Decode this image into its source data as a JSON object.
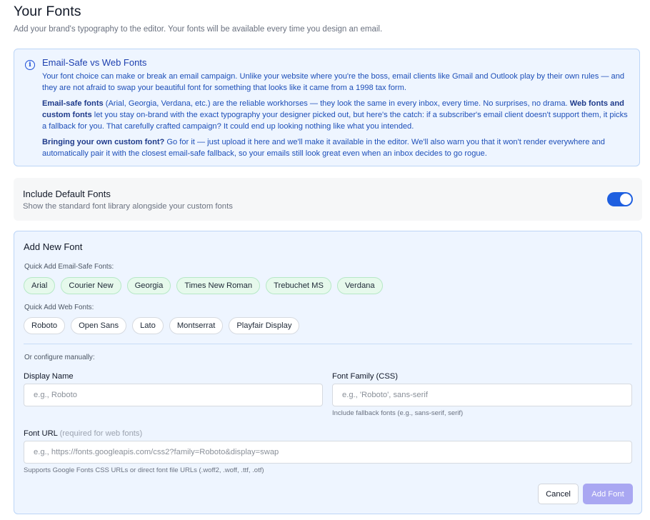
{
  "header": {
    "title": "Your Fonts",
    "subtitle": "Add your brand's typography to the editor. Your fonts will be available every time you design an email."
  },
  "info": {
    "icon": "info-icon",
    "title": "Email-Safe vs Web Fonts",
    "p1": "Your font choice can make or break an email campaign. Unlike your website where you're the boss, email clients like Gmail and Outlook play by their own rules — and they are not afraid to swap your beautiful font for something that looks like it came from a 1998 tax form.",
    "p2_bold1": "Email-safe fonts",
    "p2_text1": " (Arial, Georgia, Verdana, etc.) are the reliable workhorses — they look the same in every inbox, every time. No surprises, no drama. ",
    "p2_bold2": "Web fonts and custom fonts",
    "p2_text2": " let you stay on-brand with the exact typography your designer picked out, but here's the catch: if a subscriber's email client doesn't support them, it picks a fallback for you. That carefully crafted campaign? It could end up looking nothing like what you intended.",
    "p3_bold": "Bringing your own custom font?",
    "p3_text": " Go for it — just upload it here and we'll make it available in the editor. We'll also warn you that it won't render everywhere and automatically pair it with the closest email-safe fallback, so your emails still look great even when an inbox decides to go rogue."
  },
  "default_fonts": {
    "title": "Include Default Fonts",
    "description": "Show the standard font library alongside your custom fonts",
    "enabled": true,
    "accent": "#1e5fe0"
  },
  "add_font": {
    "title": "Add New Font",
    "email_safe_label": "Quick Add Email-Safe Fonts:",
    "email_safe_fonts": [
      "Arial",
      "Courier New",
      "Georgia",
      "Times New Roman",
      "Trebuchet MS",
      "Verdana"
    ],
    "web_label": "Quick Add Web Fonts:",
    "web_fonts": [
      "Roboto",
      "Open Sans",
      "Lato",
      "Montserrat",
      "Playfair Display"
    ],
    "manual_label": "Or configure manually:",
    "display_name": {
      "label": "Display Name",
      "placeholder": "e.g., Roboto",
      "value": ""
    },
    "font_family": {
      "label": "Font Family (CSS)",
      "placeholder": "e.g., 'Roboto', sans-serif",
      "value": "",
      "hint": "Include fallback fonts (e.g., sans-serif, serif)"
    },
    "font_url": {
      "label": "Font URL",
      "label_note": "(required for web fonts)",
      "placeholder": "e.g., https://fonts.googleapis.com/css2?family=Roboto&display=swap",
      "value": "",
      "hint": "Supports Google Fonts CSS URLs or direct font file URLs (.woff2, .woff, .ttf, .otf)"
    },
    "cancel_label": "Cancel",
    "add_label": "Add Font",
    "add_button_color": "#a9a7f2"
  }
}
